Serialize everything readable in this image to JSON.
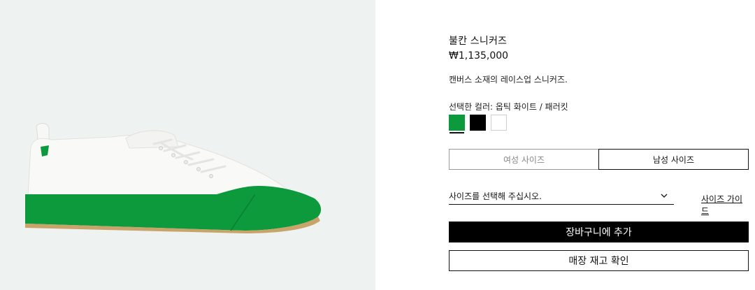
{
  "product": {
    "title": "불칸 스니커즈",
    "price": "₩1,135,000",
    "description": "캔버스 소재의 레이스업 스니커즈.",
    "color_label": "선택한 컬러: 옵틱 화이트 / 패러킷",
    "swatches": [
      {
        "name": "parakeet-green",
        "color": "#0d9a3c",
        "selected": true
      },
      {
        "name": "black",
        "color": "#000000",
        "selected": false
      },
      {
        "name": "white",
        "color": "#ffffff",
        "selected": false
      }
    ]
  },
  "size": {
    "tabs": [
      "여성 사이즈",
      "남성 사이즈"
    ],
    "active_tab": "남성 사이즈",
    "select_placeholder": "사이즈를 선택해 주십시오.",
    "guide_label": "사이즈 가이드"
  },
  "actions": {
    "add_to_cart": "장바구니에 추가",
    "check_store_stock": "매장 재고 확인"
  },
  "colors": {
    "image_bg": "#eef2f1",
    "sole_green": "#0d9a3c",
    "primary_button": "#000000"
  }
}
